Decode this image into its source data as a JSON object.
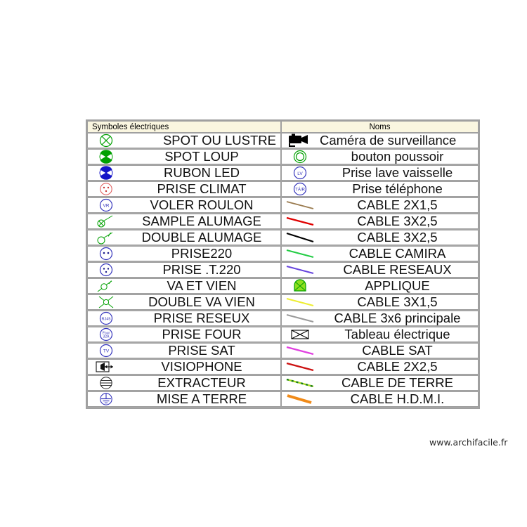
{
  "watermark": "www.archifacile.fr",
  "table": {
    "headers": {
      "left": "Symboles électriques",
      "right": "Noms"
    },
    "left_rows": [
      {
        "icon": "spot-ou-lustre-icon",
        "label": "SPOT OU LUSTRE",
        "color": "#00a000"
      },
      {
        "icon": "spot-loup-icon",
        "label": "SPOT LOUP",
        "color": "#00a000"
      },
      {
        "icon": "rubon-led-icon",
        "label": "RUBON LED",
        "color": "#1414c8"
      },
      {
        "icon": "prise-climat-icon",
        "label": "PRISE CLIMAT",
        "color": "#e06060"
      },
      {
        "icon": "voler-roulon-icon",
        "label": "VOLER ROULON",
        "color": "#3333bb"
      },
      {
        "icon": "sample-alumage-icon",
        "label": "SAMPLE ALUMAGE",
        "color": "#00a000"
      },
      {
        "icon": "double-alumage-icon",
        "label": "DOUBLE ALUMAGE",
        "color": "#00a000"
      },
      {
        "icon": "prise220-icon",
        "label": "PRISE220",
        "color": "#3333bb"
      },
      {
        "icon": "prise-t-220-icon",
        "label": "PRISE .T.220",
        "color": "#3333bb"
      },
      {
        "icon": "va-et-vien-icon",
        "label": "VA ET VIEN",
        "color": "#00a000"
      },
      {
        "icon": "double-va-vien-icon",
        "label": "DOUBLE VA VIEN",
        "color": "#00a000"
      },
      {
        "icon": "prise-reseux-icon",
        "label": "PRISE RESEUX",
        "color": "#3333bb"
      },
      {
        "icon": "prise-four-icon",
        "label": "PRISE FOUR",
        "color": "#3333bb"
      },
      {
        "icon": "prise-sat-icon",
        "label": "PRISE SAT",
        "color": "#3333bb"
      },
      {
        "icon": "visiophone-icon",
        "label": "VISIOPHONE",
        "color": "#111111"
      },
      {
        "icon": "extracteur-icon",
        "label": "EXTRACTEUR",
        "color": "#111111"
      },
      {
        "icon": "mise-a-terre-icon",
        "label": "MISE A TERRE",
        "color": "#3333bb"
      }
    ],
    "left_symbol_texts": {
      "voler_roulon": "VR",
      "prise_reseux": "RJ45",
      "prise_four": "Four 32A",
      "prise_sat": "TV"
    },
    "right_rows": [
      {
        "icon": "camera-surveillance-icon",
        "label": "Caméra de surveillance",
        "color": "#000000"
      },
      {
        "icon": "bouton-poussoir-icon",
        "label": "bouton poussoir",
        "color": "#00a000"
      },
      {
        "icon": "prise-lave-vaisselle-icon",
        "label": "Prise lave vaisselle",
        "color": "#3333bb"
      },
      {
        "icon": "prise-telephone-icon",
        "label": "Prise téléphone",
        "color": "#3333bb"
      },
      {
        "icon": "cable-2x1-5-icon",
        "label": "CABLE 2X1,5",
        "color": "#9a7b4f"
      },
      {
        "icon": "cable-3x2-5-red-icon",
        "label": "CABLE 3X2,5",
        "color": "#e00000"
      },
      {
        "icon": "cable-3x2-5-black-icon",
        "label": "CABLE 3X2,5",
        "color": "#000000"
      },
      {
        "icon": "cable-camira-icon",
        "label": "CABLE CAMIRA",
        "color": "#22cc44"
      },
      {
        "icon": "cable-reseaux-icon",
        "label": "CABLE RESEAUX",
        "color": "#6644dd"
      },
      {
        "icon": "applique-icon",
        "label": "APPLIQUE",
        "color": "#8ede1e"
      },
      {
        "icon": "cable-3x1-5-icon",
        "label": "CABLE 3X1,5",
        "color": "#eeee33"
      },
      {
        "icon": "cable-3x6-principale-icon",
        "label": "CABLE 3x6 principale",
        "color": "#9a9a9a"
      },
      {
        "icon": "tableau-electrique-icon",
        "label": "Tableau électrique",
        "color": "#000000"
      },
      {
        "icon": "cable-sat-icon",
        "label": "CABLE SAT",
        "color": "#e040e0"
      },
      {
        "icon": "cable-2x2-5-icon",
        "label": "CABLE 2X2,5",
        "color": "#cc1111"
      },
      {
        "icon": "cable-de-terre-icon",
        "label": "CABLE DE TERRE",
        "color": "#aadd22"
      },
      {
        "icon": "cable-hdmi-icon",
        "label": "CABLE H.D.M.I.",
        "color": "#f08a18"
      }
    ],
    "right_symbol_texts": {
      "prise_lave_vaisselle": "LV",
      "prise_telephone": "TÁ/R"
    }
  },
  "colors": {
    "header_bg": "#faf6e0",
    "grid": "#a0a0a0",
    "row_bg": "#ffffff",
    "page_bg": "#ffffff"
  }
}
